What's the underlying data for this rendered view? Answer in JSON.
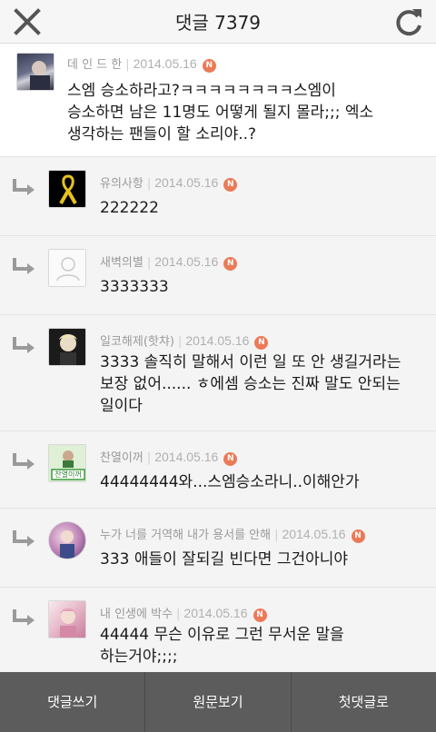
{
  "header": {
    "title": "댓글 7379"
  },
  "comments": [
    {
      "author": "데 인 드 한",
      "date": "2014.05.16",
      "badge": "N",
      "text_lines": [
        "스엠 승소하라고?ㅋㅋㅋㅋㅋㅋㅋㅋ스엠이",
        "승소하면 남은 11명도 어떻게 될지 몰라;;; 엑소",
        "생각하는 팬들이 할 소리야..?"
      ],
      "avatar": "user-photo-dark"
    },
    {
      "author": "유의사항",
      "date": "2014.05.16",
      "badge": "N",
      "text_lines": [
        "222222"
      ],
      "avatar": "yellow-ribbon"
    },
    {
      "author": "새벽의별",
      "date": "2014.05.16",
      "badge": "N",
      "text_lines": [
        "3333333"
      ],
      "avatar": "default-profile"
    },
    {
      "author": "일코해제(핫챠)",
      "date": "2014.05.16",
      "badge": "N",
      "text_lines": [
        "3333 솔직히 말해서 이런 일 또 안 생길거라는",
        "보장 없어...... ㅎ에셈 승소는 진짜 말도 안되는",
        "일이다"
      ],
      "avatar": "user-photo-blond"
    },
    {
      "author": "찬열이꺼",
      "date": "2014.05.16",
      "badge": "N",
      "text_lines": [
        "44444444와...스엠승소라니..이해안가"
      ],
      "avatar": "user-photo-green",
      "avatar_caption": "찬열이꺼"
    },
    {
      "author": "누가 너를 거역해 내가 용서를 안해",
      "date": "2014.05.16",
      "badge": "N",
      "text_lines": [
        "333 애들이 잘되길 빈다면 그건아니야"
      ],
      "avatar": "user-photo-round"
    },
    {
      "author": "내 인생에 박수",
      "date": "2014.05.16",
      "badge": "N",
      "text_lines": [
        "44444 무슨 이유로 그런 무서운 말을",
        "하는거야;;;;"
      ],
      "avatar": "user-photo-pink"
    }
  ],
  "footer": {
    "write": "댓글쓰기",
    "original": "원문보기",
    "first": "첫댓글로"
  },
  "colors": {
    "badge": "#ec7a57",
    "footer_bg": "#5c5c5c",
    "reply_bg": "#f4f4f4"
  }
}
